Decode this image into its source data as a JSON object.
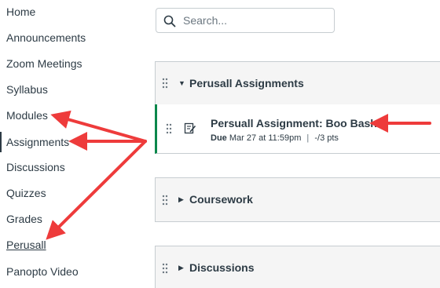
{
  "course_nav": {
    "items": [
      {
        "label": "Home"
      },
      {
        "label": "Announcements"
      },
      {
        "label": "Zoom Meetings"
      },
      {
        "label": "Syllabus"
      },
      {
        "label": "Modules"
      },
      {
        "label": "Assignments"
      },
      {
        "label": "Discussions"
      },
      {
        "label": "Quizzes"
      },
      {
        "label": "Grades"
      },
      {
        "label": "Perusall"
      },
      {
        "label": "Panopto Video"
      }
    ]
  },
  "search": {
    "placeholder": "Search...",
    "value": ""
  },
  "modules": [
    {
      "title": "Perusall Assignments",
      "expanded": true,
      "items": [
        {
          "title": "Persuall Assignment: Boo Bash",
          "due_label": "Due",
          "due_date": "Mar 27 at 11:59pm",
          "separator": "|",
          "points": "-/3 pts",
          "icon": "assignment-icon"
        }
      ]
    },
    {
      "title": "Coursework",
      "expanded": false
    },
    {
      "title": "Discussions",
      "expanded": false
    }
  ],
  "colors": {
    "text": "#2d3b45",
    "accent_green": "#0b874b",
    "arrow_red": "#ee3b3b",
    "module_header_bg": "#f5f5f5"
  }
}
